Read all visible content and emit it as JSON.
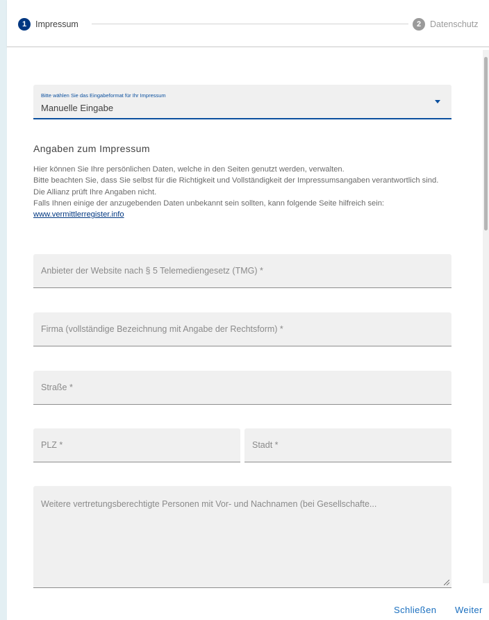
{
  "stepper": {
    "steps": [
      {
        "number": "1",
        "label": "Impressum"
      },
      {
        "number": "2",
        "label": "Datenschutz"
      }
    ]
  },
  "format_select": {
    "label": "Bitte wählen Sie das Eingabeformat für Ihr Impressum",
    "value": "Manuelle Eingabe"
  },
  "section": {
    "title": "Angaben zum Impressum",
    "lines": [
      "Hier können Sie Ihre persönlichen Daten, welche in den Seiten genutzt werden, verwalten.",
      "Bitte beachten Sie, dass Sie selbst für die Richtigkeit und Vollständigkeit der Impressumsangaben verantwortlich sind.",
      "Die Allianz prüft Ihre Angaben nicht.",
      "Falls Ihnen einige der anzugebenden Daten unbekannt sein sollten, kann folgende Seite hilfreich sein:"
    ],
    "link": "www.vermittlerregister.info"
  },
  "fields": {
    "anbieter": "Anbieter der Website nach § 5 Telemediengesetz (TMG) *",
    "firma": "Firma (vollständige Bezeichnung mit Angabe der Rechtsform) *",
    "strasse": "Straße *",
    "plz": "PLZ *",
    "stadt": "Stadt *",
    "weitere": "Weitere vertretungsberechtigte Personen mit Vor- und Nachnamen (bei Gesellschafte..."
  },
  "actions": {
    "close": "Schließen",
    "next": "Weiter"
  },
  "colors": {
    "primary": "#003781",
    "link": "#1a6fbf",
    "background": "#e3eff3"
  }
}
